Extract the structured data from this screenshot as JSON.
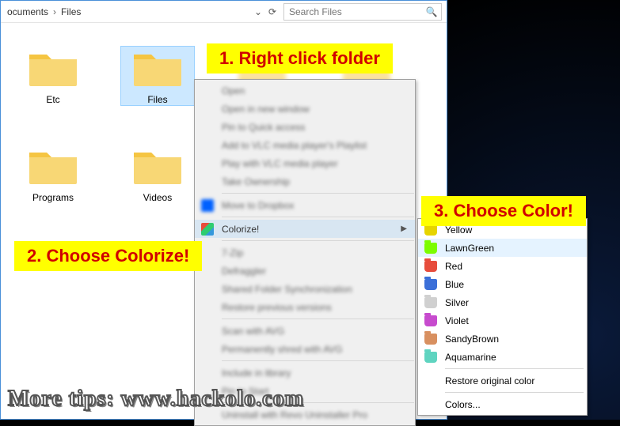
{
  "breadcrumb": {
    "part1": "ocuments",
    "part2": "Files"
  },
  "search": {
    "placeholder": "Search Files"
  },
  "folders": [
    {
      "name": "Etc"
    },
    {
      "name": "Files"
    },
    {
      "name": "Programs"
    },
    {
      "name": "Videos"
    }
  ],
  "context_menu": {
    "blurred": [
      "Open",
      "Open in new window",
      "Pin to Quick access",
      "Add to VLC media player's Playlist",
      "Play with VLC media player",
      "Take Ownership"
    ],
    "dropbox_row": "Move to Dropbox",
    "colorize_label": "Colorize!",
    "blurred_after": [
      "7-Zip",
      "Defraggler",
      "Shared Folder Synchronization",
      "Restore previous versions",
      "Scan with AVG",
      "Permanently shred with AVG",
      "Include in library",
      "Pin to Start",
      "Uninstall with Revo Uninstaller Pro"
    ]
  },
  "colors_submenu": {
    "items": [
      {
        "label": "Yellow",
        "hex": "#e6d400"
      },
      {
        "label": "LawnGreen",
        "hex": "#7cfc00"
      },
      {
        "label": "Red",
        "hex": "#e74c3c"
      },
      {
        "label": "Blue",
        "hex": "#3b6fd8"
      },
      {
        "label": "Silver",
        "hex": "#d0d0d0"
      },
      {
        "label": "Violet",
        "hex": "#c74bce"
      },
      {
        "label": "SandyBrown",
        "hex": "#d89060"
      },
      {
        "label": "Aquamarine",
        "hex": "#5fd4c0"
      }
    ],
    "restore_label": "Restore original color",
    "more_label": "Colors..."
  },
  "callouts": {
    "step1": "1. Right click folder",
    "step2": "2. Choose Colorize!",
    "step3": "3. Choose Color!"
  },
  "tips": "More tips: www.hackolo.com"
}
